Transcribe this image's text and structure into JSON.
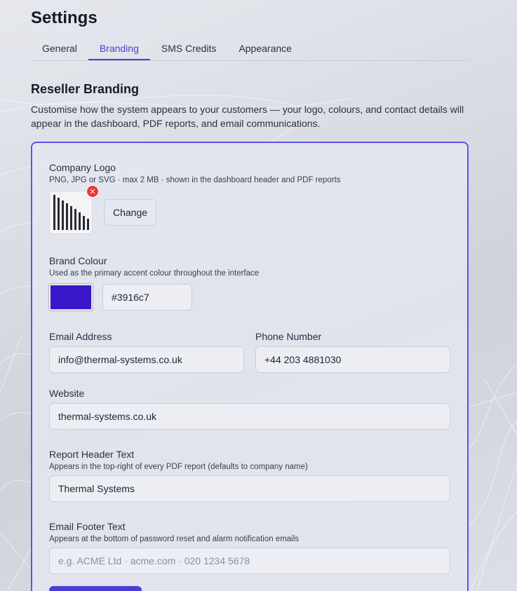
{
  "page": {
    "title": "Settings"
  },
  "tabs": [
    {
      "label": "General",
      "active": false
    },
    {
      "label": "Branding",
      "active": true
    },
    {
      "label": "SMS Credits",
      "active": false
    },
    {
      "label": "Appearance",
      "active": false
    }
  ],
  "section": {
    "title": "Reseller Branding",
    "description": "Customise how the system appears to your customers — your logo, colours, and contact details will appear in the dashboard, PDF reports, and email communications."
  },
  "logo": {
    "label": "Company Logo",
    "hint": "PNG, JPG or SVG · max 2 MB · shown in the dashboard header and PDF reports",
    "change_label": "Change",
    "remove_icon": "close-icon"
  },
  "brand_colour": {
    "label": "Brand Colour",
    "hint": "Used as the primary accent colour throughout the interface",
    "value": "#3916c7"
  },
  "email": {
    "label": "Email Address",
    "value": "info@thermal-systems.co.uk"
  },
  "phone": {
    "label": "Phone Number",
    "value": "+44 203 4881030"
  },
  "website": {
    "label": "Website",
    "value": "thermal-systems.co.uk"
  },
  "report_header": {
    "label": "Report Header Text",
    "hint": "Appears in the top-right of every PDF report (defaults to company name)",
    "value": "Thermal Systems"
  },
  "email_footer": {
    "label": "Email Footer Text",
    "hint": "Appears at the bottom of password reset and alarm notification emails",
    "placeholder": "e.g. ACME Ltd · acme.com · 020 1234 5678"
  },
  "colors": {
    "accent": "#4a3ed6",
    "brand": "#3916c7",
    "danger": "#ea3a3a"
  }
}
